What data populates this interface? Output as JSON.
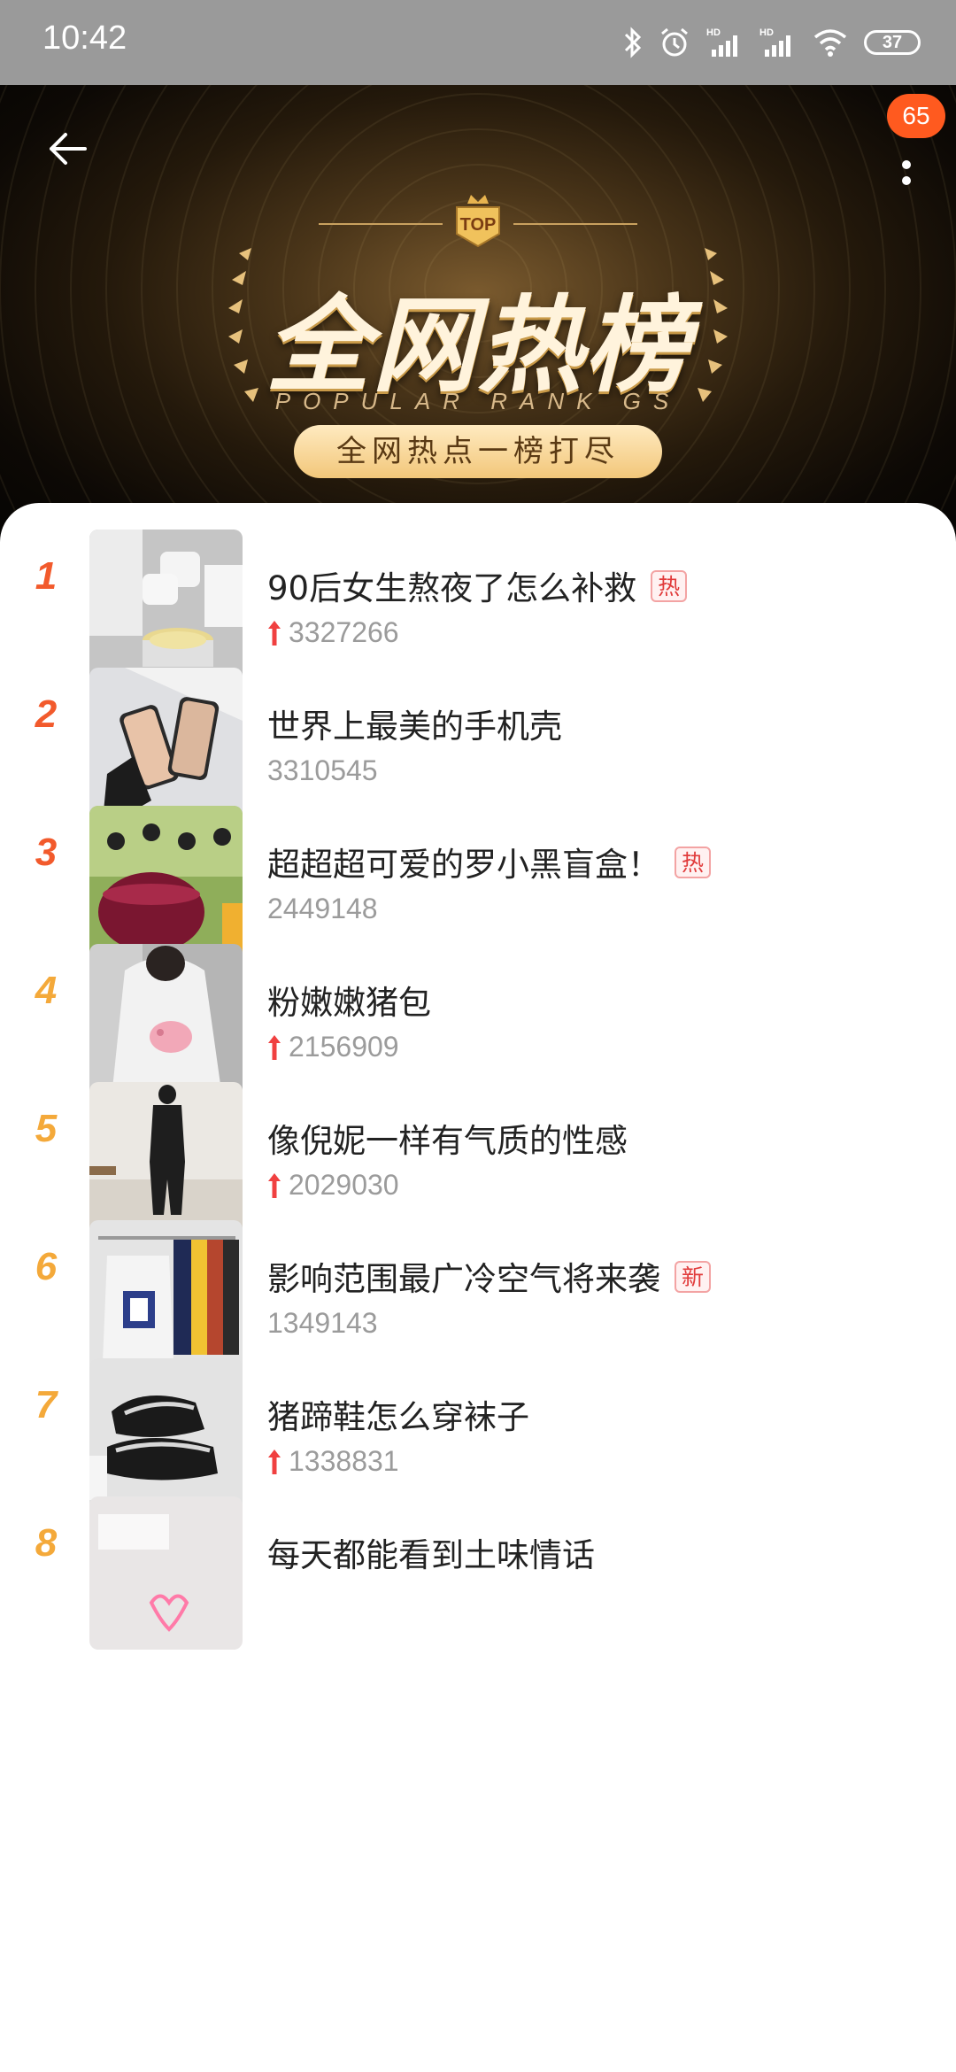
{
  "status_bar": {
    "time": "10:42",
    "battery": "37",
    "icons": [
      "bluetooth-icon",
      "alarm-icon",
      "hd-signal-icon",
      "hd-signal-icon",
      "wifi-icon",
      "battery-icon"
    ]
  },
  "header": {
    "back_icon": "arrow-left-icon",
    "more_icon": "more-vertical-icon",
    "badge_count": "65",
    "top_label": "TOP",
    "title": "全网热榜",
    "subtitle_en": "POPULAR RANK GS",
    "slogan": "全网热点一榜打尽",
    "colors": {
      "gold": "#f2c77a",
      "dark": "#0d0905",
      "badge": "#ff5a1f"
    }
  },
  "list": {
    "rank_colors": {
      "top": "#f25a2c",
      "rest": "#f4a93a"
    },
    "items": [
      {
        "rank": "1",
        "title": "90后女生熬夜了怎么补救",
        "tag": "热",
        "count": "3327266",
        "trend": "up"
      },
      {
        "rank": "2",
        "title": "世界上最美的手机壳",
        "tag": "",
        "count": "3310545",
        "trend": "none"
      },
      {
        "rank": "3",
        "title": "超超超可爱的罗小黑盲盒！",
        "tag": "热",
        "count": "2449148",
        "trend": "none"
      },
      {
        "rank": "4",
        "title": "粉嫩嫩猪包",
        "tag": "",
        "count": "2156909",
        "trend": "up"
      },
      {
        "rank": "5",
        "title": "像倪妮一样有气质的性感",
        "tag": "",
        "count": "2029030",
        "trend": "up"
      },
      {
        "rank": "6",
        "title": "影响范围最广冷空气将来袭",
        "tag": "新",
        "count": "1349143",
        "trend": "none"
      },
      {
        "rank": "7",
        "title": "猪蹄鞋怎么穿袜子",
        "tag": "",
        "count": "1338831",
        "trend": "up"
      },
      {
        "rank": "8",
        "title": "每天都能看到土味情话",
        "tag": "",
        "count": "",
        "trend": "none"
      }
    ]
  }
}
